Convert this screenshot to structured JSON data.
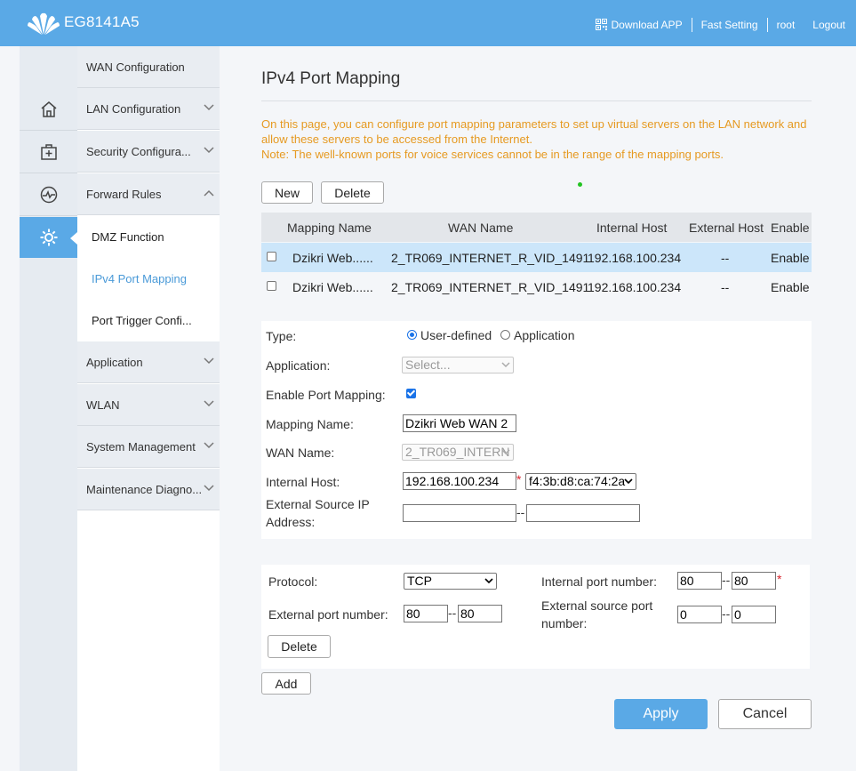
{
  "header": {
    "title": "EG8141A5",
    "links": {
      "download_app": "Download APP",
      "fast_setting": "Fast Setting",
      "user": "root",
      "logout": "Logout"
    },
    "icons": {
      "logo": "huawei-logo",
      "qr": "qr-code-icon"
    },
    "bg_color": "#5aa9e6"
  },
  "rail": {
    "icons": [
      "home-icon",
      "first-aid-kit-icon",
      "pulse-monitor-icon",
      "gear-icon"
    ],
    "active": "gear-icon"
  },
  "menu": {
    "wan": "WAN Configuration",
    "lan": "LAN Configuration",
    "security": "Security Configura...",
    "forward": "Forward Rules",
    "sub": {
      "dmz": "DMZ Function",
      "ipv4": "IPv4 Port Mapping",
      "trigger": "Port Trigger Confi..."
    },
    "application": "Application",
    "wlan": "WLAN",
    "system": "System Management",
    "maintenance": "Maintenance Diagno..."
  },
  "page": {
    "title": "IPv4 Port Mapping",
    "notice_line1": "On this page, you can configure port mapping parameters to set up virtual servers on the LAN network and allow these servers to be accessed from the Internet.",
    "notice_line2": "Note: The well-known ports for voice services cannot be in the range of the mapping ports.",
    "notice_color": "#e69a22",
    "buttons": {
      "new": "New",
      "delete": "Delete"
    }
  },
  "table": {
    "headers": {
      "mapping_name": "Mapping Name",
      "wan_name": "WAN Name",
      "internal_host": "Internal Host",
      "external_host": "External Host",
      "enable": "Enable"
    },
    "rows": [
      {
        "mapping_name": "Dzikri Web......",
        "wan_name": "2_TR069_INTERNET_R_VID_1491",
        "internal_host": "192.168.100.234",
        "external_host": "--",
        "enable": "Enable",
        "selected": true
      },
      {
        "mapping_name": "Dzikri Web......",
        "wan_name": "2_TR069_INTERNET_R_VID_1491",
        "internal_host": "192.168.100.234",
        "external_host": "--",
        "enable": "Enable",
        "selected": false
      }
    ]
  },
  "form": {
    "type_label": "Type:",
    "type_user_defined": "User-defined",
    "type_application": "Application",
    "application_label": "Application:",
    "application_value": "Select...",
    "enable_label": "Enable Port Mapping:",
    "enable_checked": true,
    "mapping_name_label": "Mapping Name:",
    "mapping_name_value": "Dzikri Web WAN 2",
    "wan_name_label": "WAN Name:",
    "wan_name_value": "2_TR069_INTERN",
    "internal_host_label": "Internal Host:",
    "internal_host_value": "192.168.100.234",
    "required_mark": "*",
    "mac_value": "f4:3b:d8:ca:74:2a",
    "ext_src_ip_label_1": "External Source IP",
    "ext_src_ip_label_2": "Address:",
    "ext_src_ip_start": "",
    "ext_src_ip_end": "",
    "range_sep": "--"
  },
  "ports": {
    "protocol_label": "Protocol:",
    "protocol_value": "TCP",
    "internal_port_label": "Internal port number:",
    "internal_port_start": "80",
    "internal_port_end": "80",
    "external_port_label": "External port number:",
    "external_port_start": "80",
    "external_port_end": "80",
    "ext_src_port_label_1": "External source port",
    "ext_src_port_label_2": "number:",
    "ext_src_port_start": "0",
    "ext_src_port_end": "0",
    "delete": "Delete",
    "add": "Add"
  },
  "actions": {
    "apply": "Apply",
    "cancel": "Cancel",
    "apply_color": "#5aa9e6"
  }
}
